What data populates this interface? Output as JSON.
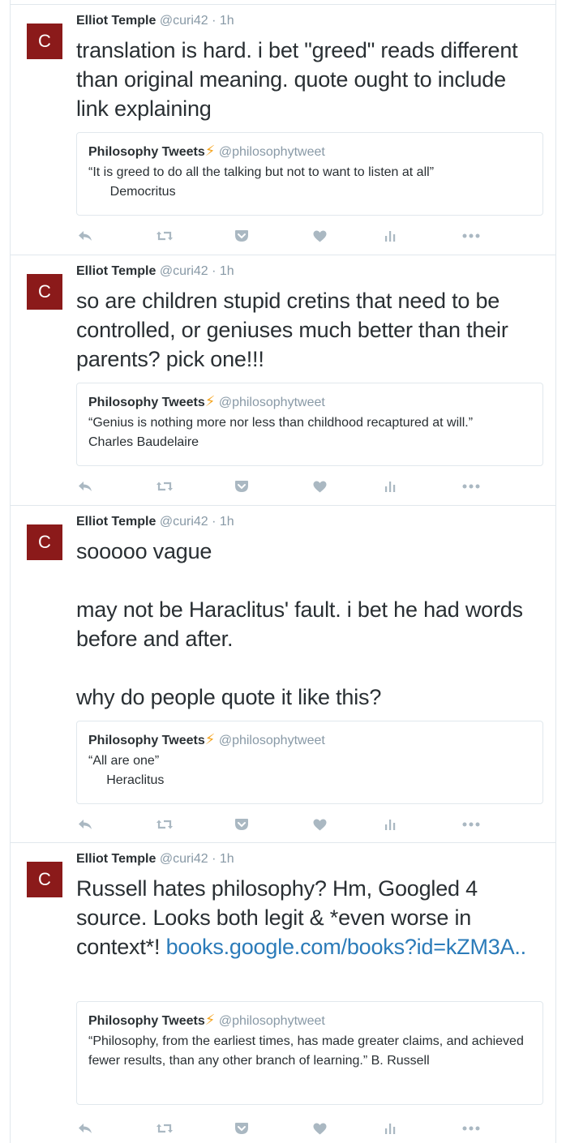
{
  "tweets": [
    {
      "author": "Elliot Temple",
      "handle": "@curi42",
      "time": "· 1h",
      "avatar_letter": "C",
      "text_paragraphs": [
        "translation is hard. i bet \"greed\" reads different than original meaning. quote ought to include link explaining"
      ],
      "quote": {
        "name": "Philosophy Tweets",
        "handle": "@philosophytweet",
        "lines": [
          "“It is greed to do all the talking but not to want to listen at all”",
          "      Democritus"
        ]
      }
    },
    {
      "author": "Elliot Temple",
      "handle": "@curi42",
      "time": "· 1h",
      "avatar_letter": "C",
      "text_paragraphs": [
        "so are children stupid cretins that need to be controlled, or geniuses much better than their parents? pick one!!!"
      ],
      "quote": {
        "name": "Philosophy Tweets",
        "handle": "@philosophytweet",
        "lines": [
          "“Genius is nothing more nor less than childhood recaptured at will.”",
          "Charles Baudelaire"
        ]
      }
    },
    {
      "author": "Elliot Temple",
      "handle": "@curi42",
      "time": "· 1h",
      "avatar_letter": "C",
      "text_paragraphs": [
        "sooooo vague",
        "may not be Haraclitus' fault. i bet he had words before and after.",
        "why do people quote it like this?"
      ],
      "quote": {
        "name": "Philosophy Tweets",
        "handle": "@philosophytweet",
        "lines": [
          "“All are one”",
          "     Heraclitus"
        ]
      }
    },
    {
      "author": "Elliot Temple",
      "handle": "@curi42",
      "time": "· 1h",
      "avatar_letter": "C",
      "text_paragraphs": [
        "Russell hates philosophy? Hm, Googled 4 source. Looks both legit & *even worse in context*!"
      ],
      "link_text": "books.google.com/books?id=kZM3A..",
      "quote": {
        "name": "Philosophy Tweets",
        "handle": "@philosophytweet",
        "lines": [
          "“Philosophy, from the earliest times, has made greater claims, and achieved fewer results, than any other branch of learning.” B. Russell"
        ]
      }
    }
  ],
  "colors": {
    "avatar_bg": "#8b1a1a",
    "link": "#2b7bb9",
    "bolt": "#f5a623",
    "muted": "#8899a6",
    "icon": "#aab8c2"
  },
  "actions": [
    "reply-icon",
    "retweet-icon",
    "pocket-icon",
    "like-icon",
    "analytics-icon",
    "more-icon"
  ]
}
